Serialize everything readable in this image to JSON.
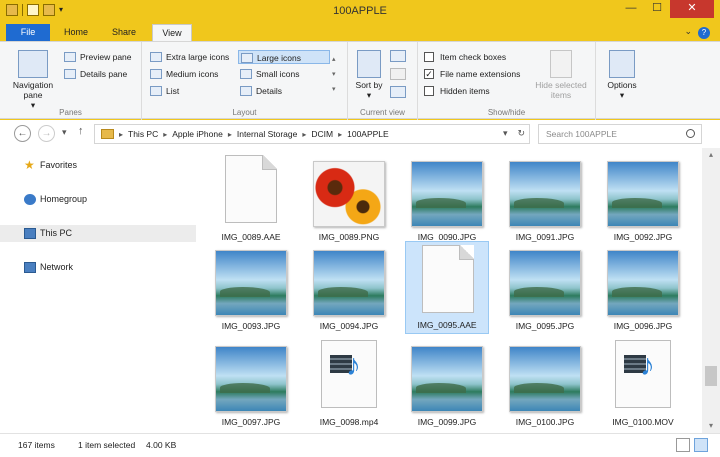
{
  "window": {
    "title": "100APPLE"
  },
  "tabs": {
    "file": "File",
    "home": "Home",
    "share": "Share",
    "view": "View"
  },
  "ribbon": {
    "panes": {
      "label": "Panes",
      "navigation_pane": "Navigation pane",
      "navigation_pane_caret": "▾",
      "preview_pane": "Preview pane",
      "details_pane": "Details pane"
    },
    "layout": {
      "label": "Layout",
      "extra_large": "Extra large icons",
      "large": "Large icons",
      "medium": "Medium icons",
      "small": "Small icons",
      "list": "List",
      "details": "Details"
    },
    "current_view": {
      "label": "Current view",
      "sort": "Sort by",
      "sort_caret": "▾"
    },
    "show_hide": {
      "label": "Show/hide",
      "item_check_boxes": "Item check boxes",
      "file_name_extensions": "File name extensions",
      "hidden_items": "Hidden items",
      "hide_selected": "Hide selected items",
      "check_mark": "✓",
      "states": {
        "item_check_boxes": false,
        "file_name_extensions": true,
        "hidden_items": false
      }
    },
    "options": {
      "label": "Options",
      "caret": "▾"
    }
  },
  "address": {
    "path": [
      "This PC",
      "Apple iPhone",
      "Internal Storage",
      "DCIM",
      "100APPLE"
    ],
    "search_placeholder": "Search 100APPLE"
  },
  "nav": {
    "favorites": "Favorites",
    "homegroup": "Homegroup",
    "this_pc": "This PC",
    "network": "Network"
  },
  "files": [
    {
      "name": "IMG_0089.AAE",
      "kind": "doc",
      "selected": false
    },
    {
      "name": "IMG_0089.PNG",
      "kind": "flower",
      "selected": false
    },
    {
      "name": "IMG_0090.JPG",
      "kind": "photo",
      "selected": false
    },
    {
      "name": "IMG_0091.JPG",
      "kind": "photo",
      "selected": false
    },
    {
      "name": "IMG_0092.JPG",
      "kind": "photo",
      "selected": false
    },
    {
      "name": "IMG_0093.JPG",
      "kind": "photo",
      "selected": false
    },
    {
      "name": "IMG_0094.JPG",
      "kind": "photo",
      "selected": false
    },
    {
      "name": "IMG_0095.AAE",
      "kind": "doc",
      "selected": true
    },
    {
      "name": "IMG_0095.JPG",
      "kind": "photo",
      "selected": false
    },
    {
      "name": "IMG_0096.JPG",
      "kind": "photo",
      "selected": false
    },
    {
      "name": "IMG_0097.JPG",
      "kind": "photo",
      "selected": false
    },
    {
      "name": "IMG_0098.mp4",
      "kind": "video",
      "selected": false
    },
    {
      "name": "IMG_0099.JPG",
      "kind": "photo",
      "selected": false
    },
    {
      "name": "IMG_0100.JPG",
      "kind": "photo",
      "selected": false
    },
    {
      "name": "IMG_0100.MOV",
      "kind": "video",
      "selected": false
    }
  ],
  "status": {
    "count": "167 items",
    "selected": "1 item selected",
    "size": "4.00 KB"
  },
  "colors": {
    "titlebar": "#f0c71c",
    "file_tab": "#1f6bd1",
    "selection": "#cce4fb",
    "close": "#c7372d"
  }
}
